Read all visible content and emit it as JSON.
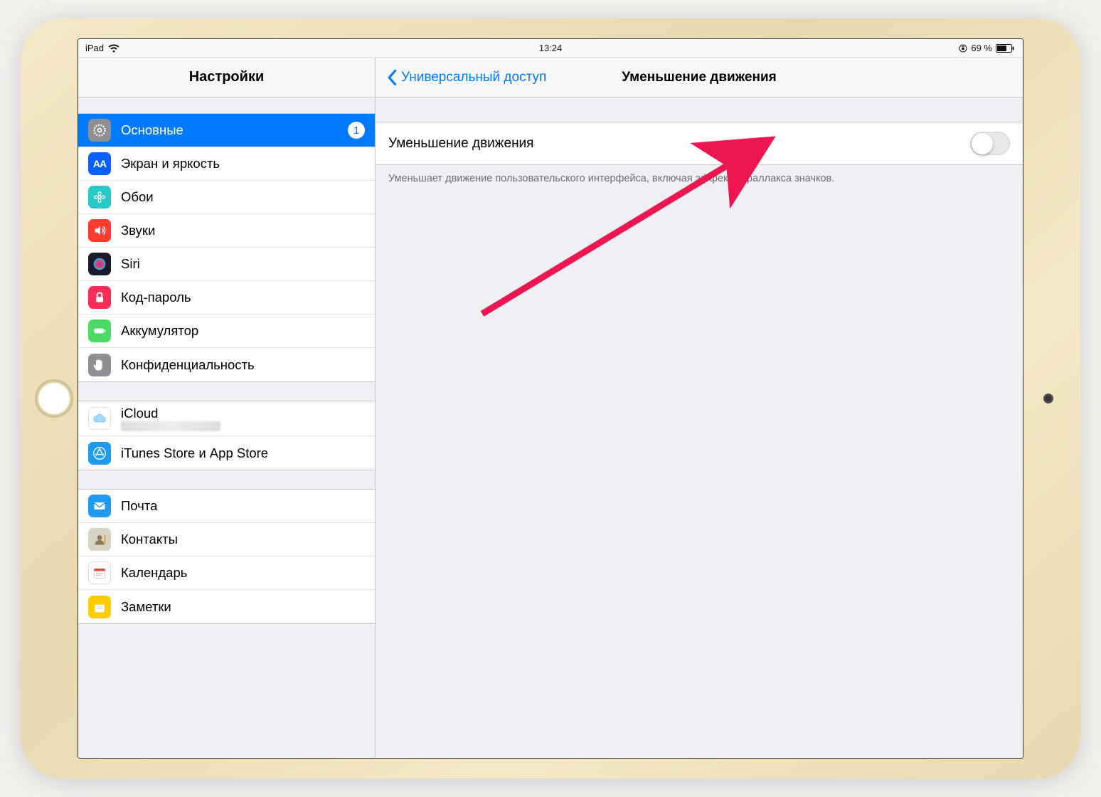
{
  "status": {
    "carrier": "iPad",
    "time": "13:24",
    "battery_pct": "69 %"
  },
  "sidebar": {
    "title": "Настройки",
    "groups": [
      {
        "items": [
          {
            "label": "Основные",
            "badge": "1",
            "selected": true,
            "icon": "gear",
            "bg": "#8e8e93"
          },
          {
            "label": "Экран и яркость",
            "icon": "AA",
            "bg": "#0a60ff"
          },
          {
            "label": "Обои",
            "icon": "flower",
            "bg": "#28c9c9"
          },
          {
            "label": "Звуки",
            "icon": "speaker",
            "bg": "#ff3b30"
          },
          {
            "label": "Siri",
            "icon": "siri",
            "bg": "#1a1a2e"
          },
          {
            "label": "Код-пароль",
            "icon": "lock",
            "bg": "#ff2d55"
          },
          {
            "label": "Аккумулятор",
            "icon": "battery",
            "bg": "#4cd964"
          },
          {
            "label": "Конфиденциальность",
            "icon": "hand",
            "bg": "#8e8e93"
          }
        ]
      },
      {
        "items": [
          {
            "label": "iCloud",
            "icon": "cloud",
            "bg": "#ffffff",
            "sub_blur": true
          },
          {
            "label": "iTunes Store и App Store",
            "icon": "appstore",
            "bg": "#1e9af1"
          }
        ]
      },
      {
        "items": [
          {
            "label": "Почта",
            "icon": "mail",
            "bg": "#1e9af1"
          },
          {
            "label": "Контакты",
            "icon": "contacts",
            "bg": "#d9d3c5"
          },
          {
            "label": "Календарь",
            "icon": "calendar",
            "bg": "#ffffff"
          },
          {
            "label": "Заметки",
            "icon": "notes",
            "bg": "#ffcc00"
          }
        ]
      }
    ]
  },
  "detail": {
    "back_label": "Универсальный доступ",
    "title": "Уменьшение движения",
    "switch_label": "Уменьшение движения",
    "footer": "Уменьшает движение пользовательского интерфейса, включая эффект параллакса значков."
  }
}
